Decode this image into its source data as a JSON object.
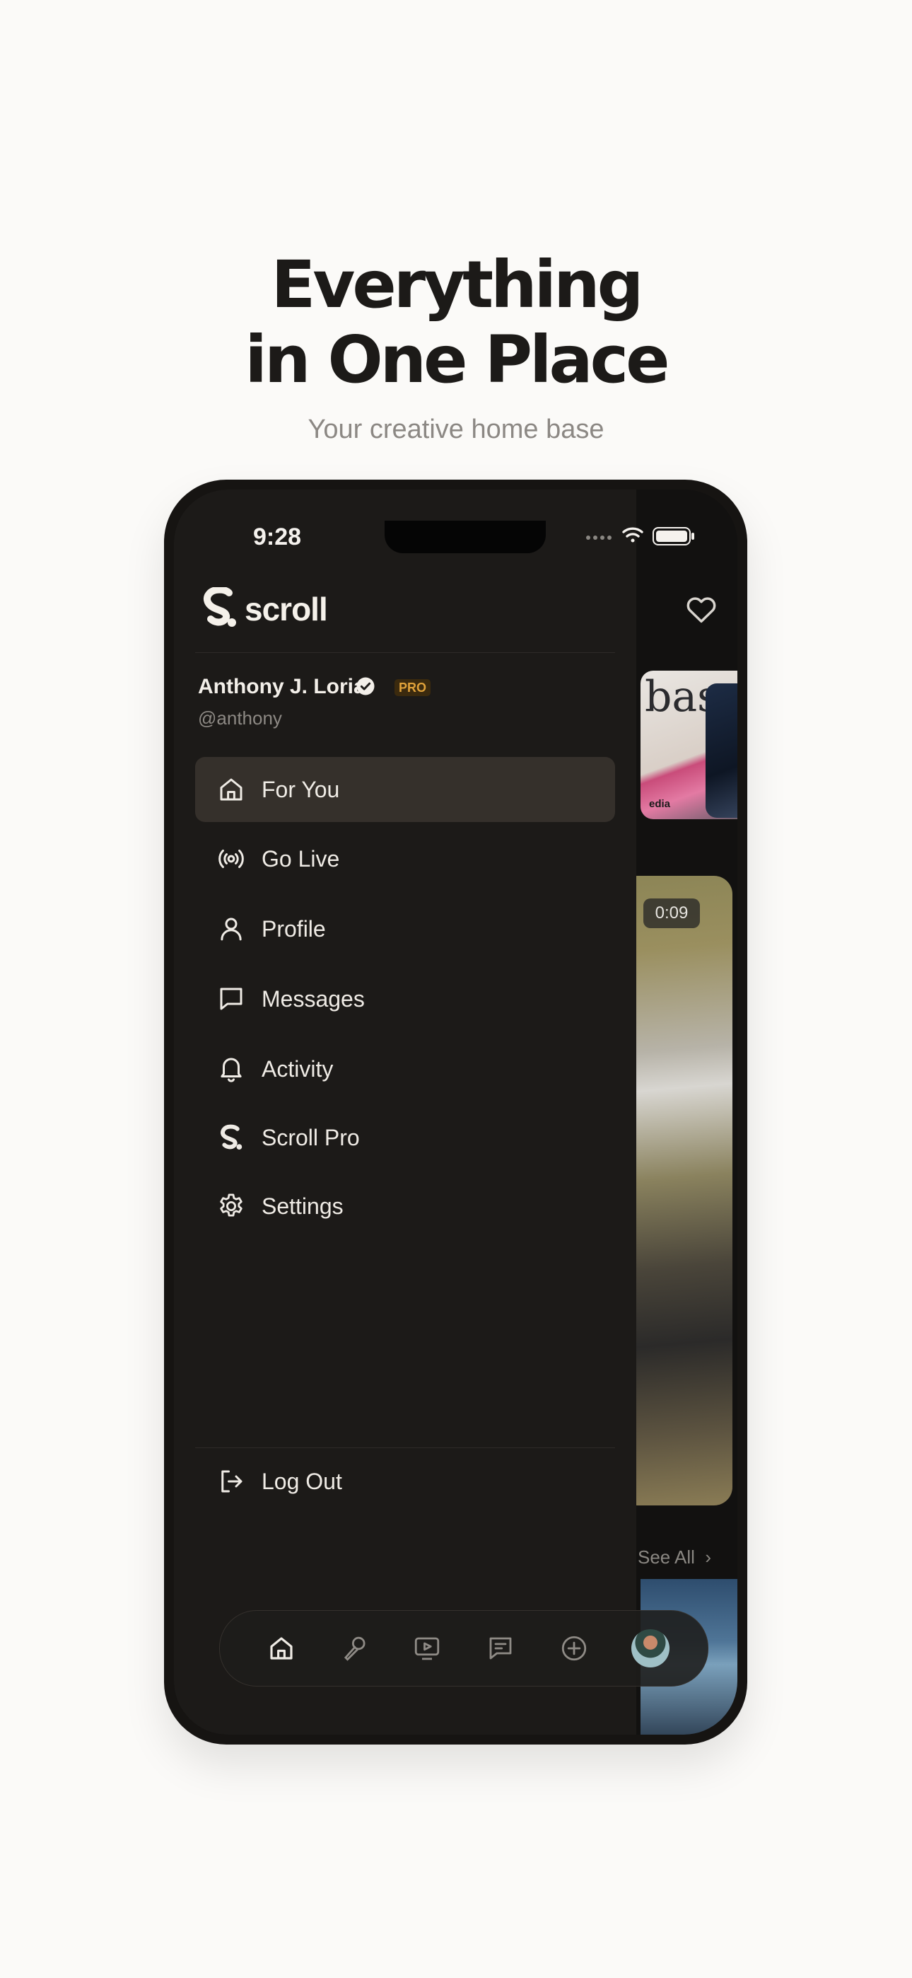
{
  "promo": {
    "headline_line1": "Everything",
    "headline_line2": "in One Place",
    "subtitle": "Your creative home base"
  },
  "status_bar": {
    "time": "9:28"
  },
  "brand": {
    "name": "scroll"
  },
  "user": {
    "name": "Anthony J. Loria",
    "badge": "PRO",
    "handle": "@anthony"
  },
  "menu": {
    "items": [
      {
        "label": "For You",
        "icon": "home-icon",
        "active": true
      },
      {
        "label": "Go Live",
        "icon": "broadcast-icon"
      },
      {
        "label": "Profile",
        "icon": "person-icon"
      },
      {
        "label": "Messages",
        "icon": "message-icon"
      },
      {
        "label": "Activity",
        "icon": "bell-icon"
      },
      {
        "label": "Scroll Pro",
        "icon": "scroll-logo-icon"
      },
      {
        "label": "Settings",
        "icon": "gear-icon"
      }
    ],
    "logout_label": "Log Out"
  },
  "background_feed": {
    "video_duration": "0:09",
    "see_all_label": "See All",
    "magazine_cover_text": "bas",
    "magazine_footer_text": "edia"
  },
  "tab_bar": {
    "items": [
      "home-icon",
      "mic-icon",
      "video-icon",
      "chat-icon",
      "add-icon",
      "avatar"
    ]
  },
  "colors": {
    "page_background": "#fbfaf8",
    "drawer_background": "#1c1a18",
    "active_item_background": "#35302b",
    "pro_badge": "#e0a23a"
  }
}
